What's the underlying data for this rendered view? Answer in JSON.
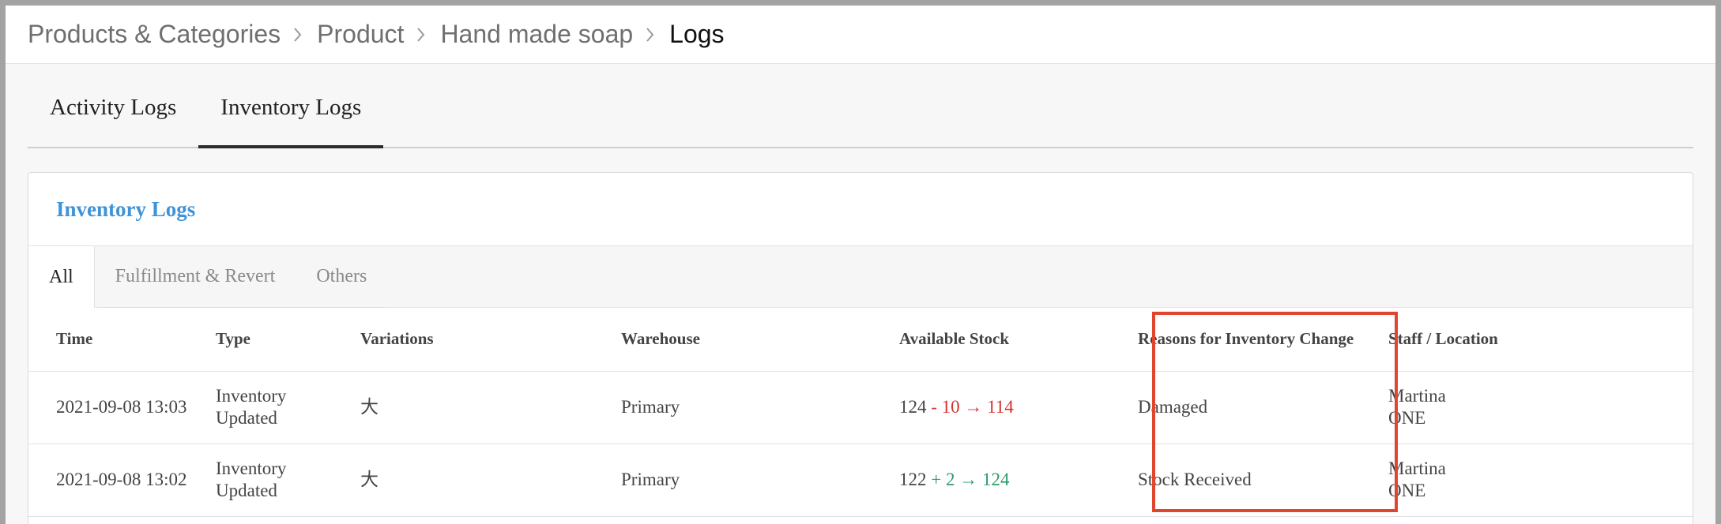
{
  "breadcrumb": {
    "items": [
      "Products & Categories",
      "Product",
      "Hand made soap"
    ],
    "current": "Logs"
  },
  "top_tabs": [
    {
      "label": "Activity Logs",
      "active": false
    },
    {
      "label": "Inventory Logs",
      "active": true
    }
  ],
  "card": {
    "title": "Inventory Logs",
    "sub_tabs": [
      {
        "label": "All",
        "active": true
      },
      {
        "label": "Fulfillment & Revert",
        "active": false
      },
      {
        "label": "Others",
        "active": false
      }
    ]
  },
  "table": {
    "headers": [
      "Time",
      "Type",
      "Variations",
      "Warehouse",
      "Available Stock",
      "Reasons for Inventory Change",
      "Staff / Location"
    ],
    "rows": [
      {
        "time": "2021-09-08 13:03",
        "type_line1": "Inventory",
        "type_line2": "Updated",
        "variation": "大",
        "warehouse": "Primary",
        "stock_before": "124",
        "stock_change": "- 10 → 114",
        "change_kind": "minus",
        "reason": "Damaged",
        "staff": "Martina",
        "location": "ONE"
      },
      {
        "time": "2021-09-08 13:02",
        "type_line1": "Inventory",
        "type_line2": "Updated",
        "variation": "大",
        "warehouse": "Primary",
        "stock_before": "122",
        "stock_change": "+ 2 → 124",
        "change_kind": "plus",
        "reason": "Stock Received",
        "staff": "Martina",
        "location": "ONE"
      }
    ]
  },
  "colors": {
    "accent_blue": "#3f93d8",
    "decrease_red": "#d9312b",
    "increase_green": "#2e9a6c",
    "highlight_box": "#e0462e"
  }
}
